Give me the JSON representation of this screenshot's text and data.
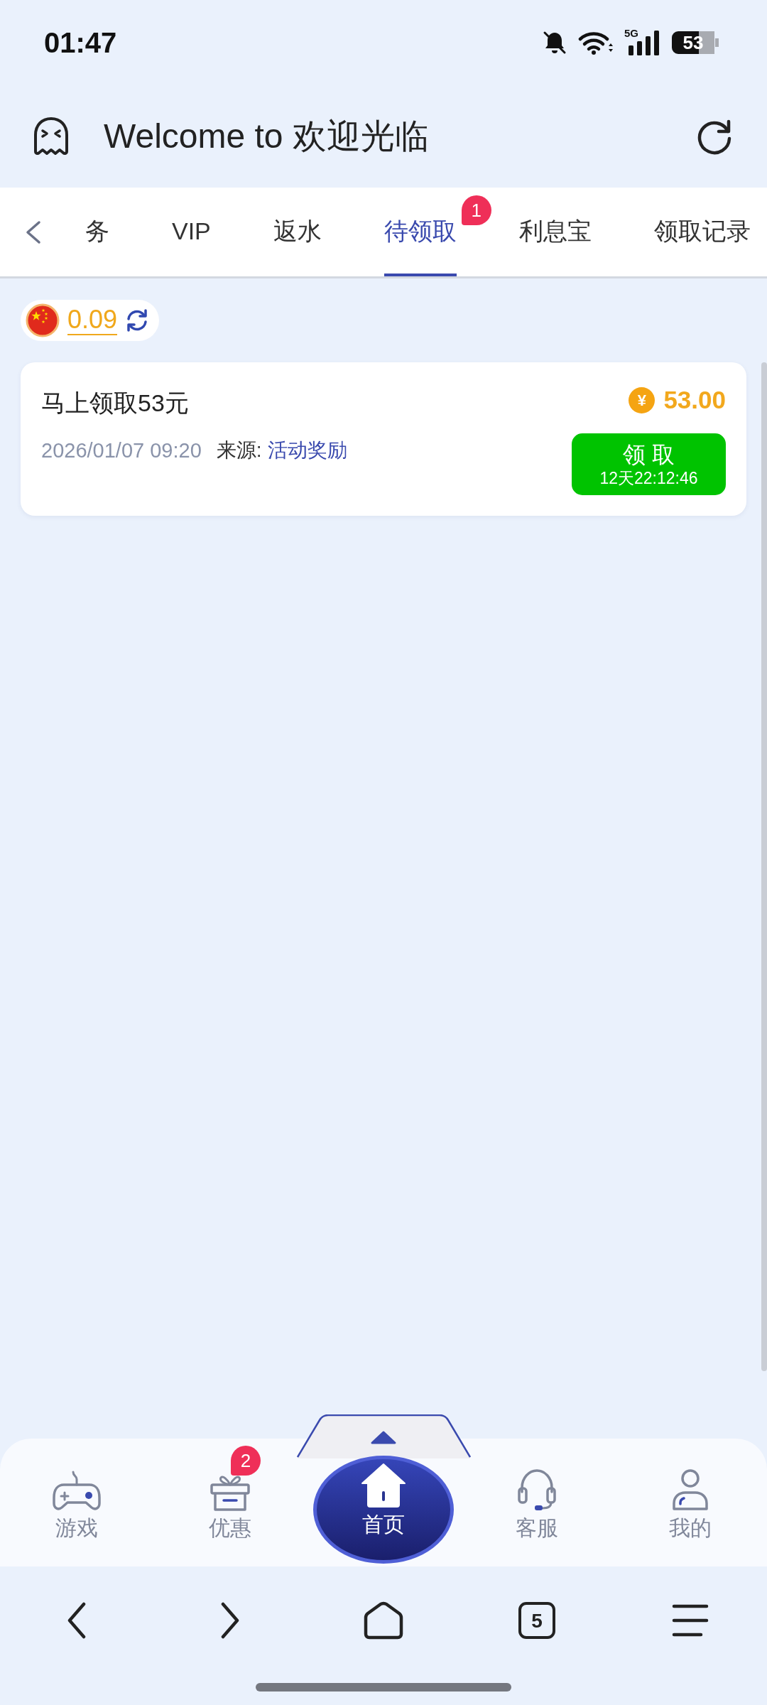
{
  "status_bar": {
    "time": "01:47",
    "network": "5G",
    "battery": "53"
  },
  "header": {
    "title": "Welcome to 欢迎光临"
  },
  "tabs": [
    {
      "label": "务",
      "selected": false
    },
    {
      "label": "VIP",
      "selected": false
    },
    {
      "label": "返水",
      "selected": false
    },
    {
      "label": "待领取",
      "selected": true,
      "badge": "1"
    },
    {
      "label": "利息宝",
      "selected": false
    },
    {
      "label": "领取记录",
      "selected": false
    }
  ],
  "balance": {
    "amount": "0.09"
  },
  "rewards": [
    {
      "title": "马上领取53元",
      "currency": "¥",
      "amount": "53.00",
      "date": "2026/01/07 09:20",
      "source_label": "来源:",
      "source": "活动奖励",
      "button": {
        "label": "领 取",
        "countdown": "12天22:12:46"
      }
    }
  ],
  "bottom_nav": [
    {
      "label": "游戏",
      "kind": "gamepad",
      "selected": false
    },
    {
      "label": "优惠",
      "kind": "gift",
      "badge": "2",
      "selected": false
    },
    {
      "label": "首页",
      "kind": "home",
      "selected": true
    },
    {
      "label": "客服",
      "kind": "headset",
      "selected": false
    },
    {
      "label": "我的",
      "kind": "user",
      "selected": false
    }
  ],
  "browser_bar": {
    "tab_count": "5"
  }
}
